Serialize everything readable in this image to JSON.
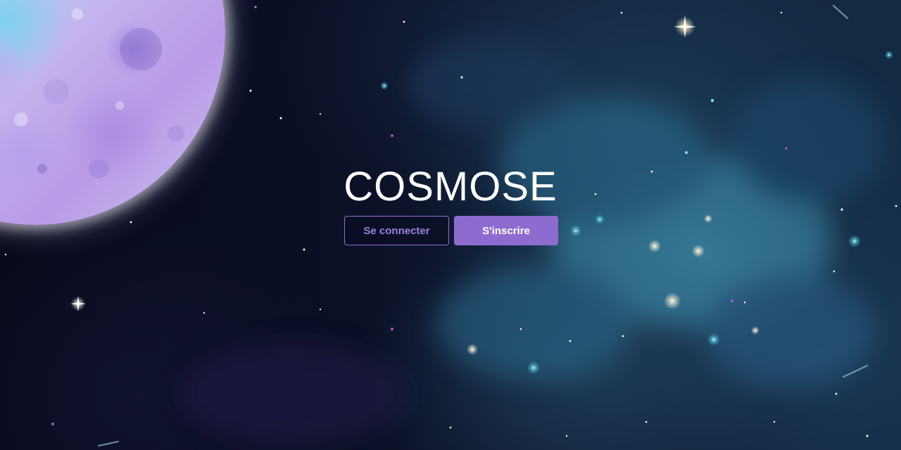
{
  "app": {
    "title": "COSMOSE"
  },
  "actions": {
    "login_label": "Se connecter",
    "signup_label": "S'inscrire"
  },
  "colors": {
    "accent": "#8e6ccf",
    "outline_text": "#9b82e0",
    "background": "#0b0f24"
  }
}
